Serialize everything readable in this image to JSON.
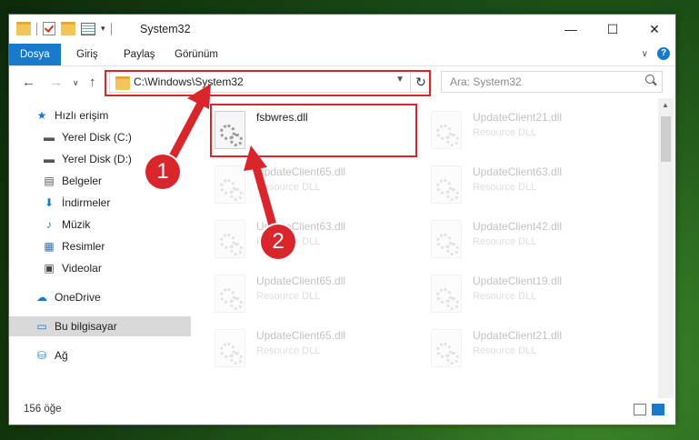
{
  "window": {
    "title": "System32",
    "controls": {
      "minimize": "—",
      "maximize": "☐",
      "close": "✕"
    }
  },
  "ribbon": {
    "tabs": [
      {
        "label": "Dosya",
        "active": true
      },
      {
        "label": "Giriş"
      },
      {
        "label": "Paylaş"
      },
      {
        "label": "Görünüm"
      }
    ],
    "expand_glyph": "∨",
    "help_glyph": "?"
  },
  "nav": {
    "back": "←",
    "forward": "→",
    "recent": "∨",
    "up": "↑"
  },
  "address": {
    "path": "C:\\Windows\\System32",
    "refresh_glyph": "↻"
  },
  "search": {
    "placeholder": "Ara: System32"
  },
  "sidebar": {
    "items": [
      {
        "label": "Hızlı erişim",
        "icon": "star-icon",
        "glyph": "★",
        "color": "#1979ca"
      },
      {
        "label": "Yerel Disk (C:)",
        "icon": "disk-icon",
        "glyph": "▬",
        "color": "#555555",
        "pinned": true
      },
      {
        "label": "Yerel Disk (D:)",
        "icon": "disk-icon",
        "glyph": "▬",
        "color": "#555555",
        "pinned": true
      },
      {
        "label": "Belgeler",
        "icon": "documents-icon",
        "glyph": "▤",
        "color": "#555555",
        "pinned": true
      },
      {
        "label": "İndirmeler",
        "icon": "download-icon",
        "glyph": "⬇",
        "color": "#1979ca",
        "pinned": true
      },
      {
        "label": "Müzik",
        "icon": "music-icon",
        "glyph": "♪",
        "color": "#1979ca",
        "pinned": true
      },
      {
        "label": "Resimler",
        "icon": "pictures-icon",
        "glyph": "▦",
        "color": "#2f6fa8",
        "pinned": true
      },
      {
        "label": "Videolar",
        "icon": "video-icon",
        "glyph": "▣",
        "color": "#444444",
        "pinned": true
      },
      {
        "label": "OneDrive",
        "icon": "cloud-icon",
        "glyph": "☁",
        "color": "#1979ca"
      },
      {
        "label": "Bu bilgisayar",
        "icon": "computer-icon",
        "glyph": "▭",
        "color": "#1979ca",
        "selected": true
      },
      {
        "label": "Ağ",
        "icon": "network-icon",
        "glyph": "⛁",
        "color": "#1979ca"
      }
    ],
    "pin_glyph": "📌"
  },
  "files": [
    {
      "name": "fsbwres.dll",
      "type": "",
      "highlighted": true
    },
    {
      "name": "UpdateClient21.dll",
      "type": "Resource DLL"
    },
    {
      "name": "UpdateClient65.dll",
      "type": "Resource DLL"
    },
    {
      "name": "UpdateClient63.dll",
      "type": "Resource DLL"
    },
    {
      "name": "UpdateClient63.dll",
      "type": "Resource DLL"
    },
    {
      "name": "UpdateClient42.dll",
      "type": "Resource DLL"
    },
    {
      "name": "UpdateClient65.dll",
      "type": "Resource DLL"
    },
    {
      "name": "UpdateClient19.dll",
      "type": "Resource DLL"
    },
    {
      "name": "UpdateClient65.dll",
      "type": "Resource DLL"
    },
    {
      "name": "UpdateClient21.dll",
      "type": "Resource DLL"
    }
  ],
  "status": {
    "count": "156 öğe"
  },
  "callouts": [
    {
      "label": "1"
    },
    {
      "label": "2"
    }
  ],
  "colors": {
    "accent": "#1979ca",
    "highlight": "#d8262c"
  }
}
